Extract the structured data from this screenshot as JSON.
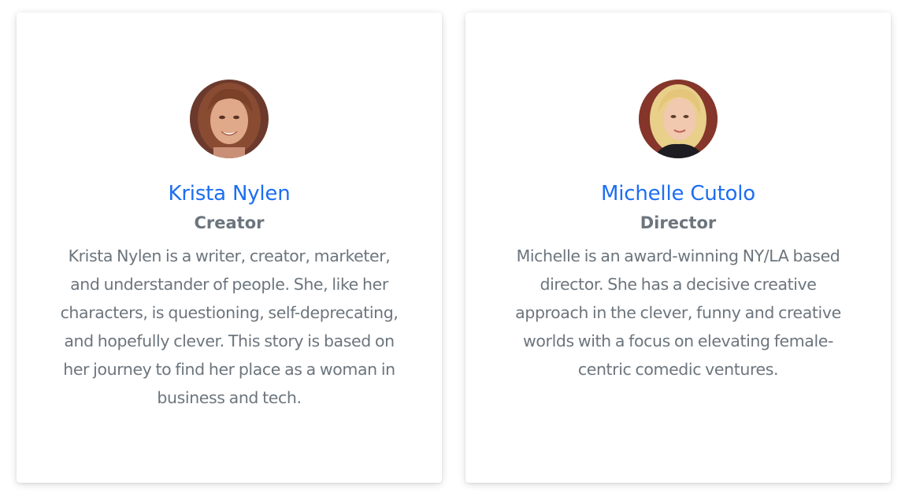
{
  "team": [
    {
      "name": "Krista Nylen",
      "role": "Creator",
      "bio": "Krista Nylen is a writer, creator, marketer, and understander of people. She, like her characters, is questioning, self-deprecating, and hopefully clever. This story is based on her journey to find her place as a woman in business and tech.",
      "avatar": "portrait-photo"
    },
    {
      "name": "Michelle Cutolo",
      "role": "Director",
      "bio": "Michelle is an award-winning NY/LA based director. She has a decisive creative approach in the clever, funny and creative worlds with a focus on elevating female-centric comedic ventures.",
      "avatar": "portrait-photo"
    }
  ],
  "colors": {
    "name_link": "#1c6ef2",
    "muted_text": "#6c757d",
    "card_background": "#ffffff"
  }
}
